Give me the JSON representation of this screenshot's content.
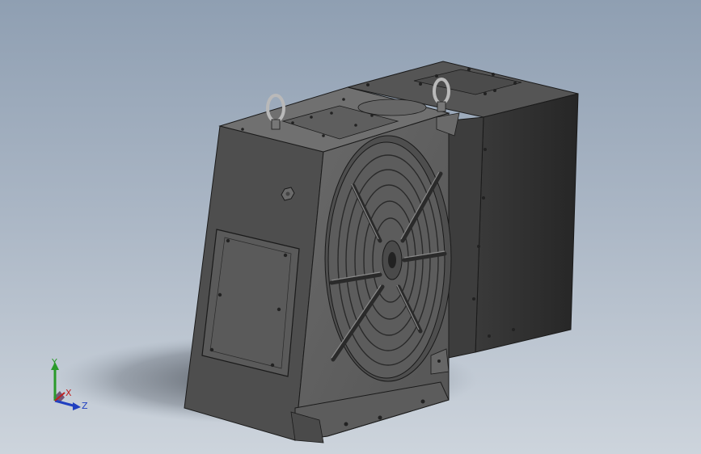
{
  "viewport": {
    "background_top": "#8f9fb2",
    "background_bottom": "#cdd4dc"
  },
  "model": {
    "body_color": "#5b5b5b",
    "side_color": "#4a4a4a",
    "top_color": "#6e6e6e",
    "motor_color": "#2f2f2f",
    "edge_color": "#1a1a1a"
  },
  "triad": {
    "x_label": "X",
    "y_label": "Y",
    "z_label": "Z",
    "x_color": "#c02020",
    "y_color": "#2a9a2a",
    "z_color": "#2040c0"
  }
}
